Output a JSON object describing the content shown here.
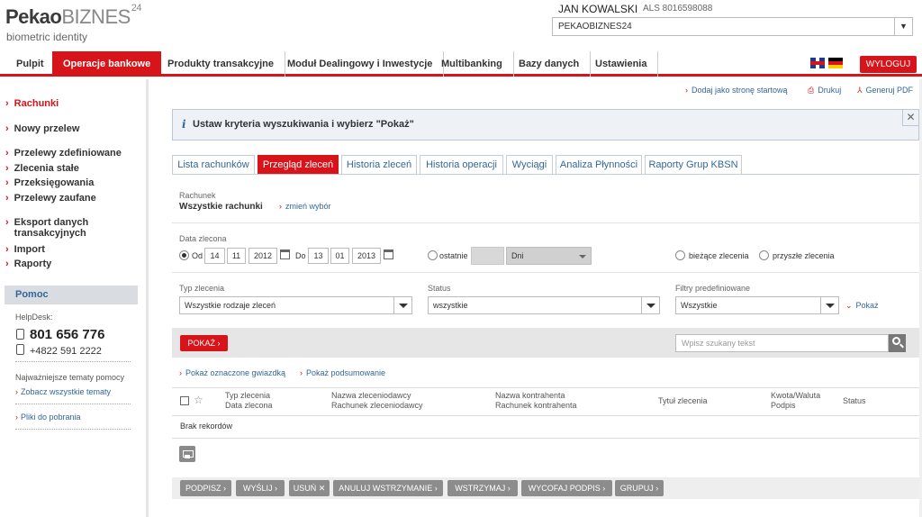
{
  "brand": {
    "logo_pekao": "Pekao",
    "logo_bizness": "BIZNES",
    "logo_sup": "24",
    "tagline": "biometric identity"
  },
  "user": {
    "name": "JAN KOWALSKI",
    "als": "ALS 8016598088",
    "context": "PEKAOBIZNES24"
  },
  "nav": {
    "items": [
      {
        "label": "Pulpit"
      },
      {
        "label": "Operacje bankowe"
      },
      {
        "label": "Produkty transakcyjne"
      },
      {
        "label": "Moduł Dealingowy i Inwestycje"
      },
      {
        "label": "Multibanking"
      },
      {
        "label": "Bazy danych"
      },
      {
        "label": "Ustawienia"
      }
    ],
    "logout": "WYLOGUJ"
  },
  "sidebar": {
    "items": [
      {
        "label": "Rachunki"
      },
      {
        "label": "Nowy przelew"
      },
      {
        "label": "Przelewy zdefiniowane"
      },
      {
        "label": "Zlecenia stałe"
      },
      {
        "label": "Przeksięgowania"
      },
      {
        "label": "Przelewy zaufane"
      },
      {
        "label": "Eksport danych"
      },
      {
        "label": "transakcyjnych"
      },
      {
        "label": "Import"
      },
      {
        "label": "Raporty"
      }
    ],
    "help": {
      "title": "Pomoc",
      "helpdesk_label": "HelpDesk:",
      "phone1": "801 656 776",
      "phone2": "+4822 591 2222",
      "topics_label": "Najważniejsze tematy pomocy",
      "all_topics": "Zobacz wszystkie tematy",
      "downloads": "Pliki do pobrania"
    }
  },
  "top_actions": {
    "add_start": "Dodaj jako stronę startową",
    "print": "Drukuj",
    "pdf": "Generuj PDF"
  },
  "info": {
    "icon": "i",
    "message": "Ustaw kryteria wyszukiwania i wybierz \"Pokaż\"",
    "close": "✕"
  },
  "tabs": [
    {
      "label": "Lista rachunków"
    },
    {
      "label": "Przegląd zleceń"
    },
    {
      "label": "Historia zleceń"
    },
    {
      "label": "Historia operacji"
    },
    {
      "label": "Wyciągi"
    },
    {
      "label": "Analiza Płynności"
    },
    {
      "label": "Raporty Grup KBSN"
    }
  ],
  "account": {
    "label": "Rachunek",
    "value": "Wszystkie rachunki",
    "change": "zmień wybór"
  },
  "date": {
    "label": "Data zlecona",
    "from_label": "Od",
    "from_day": "14",
    "from_month": "11",
    "from_year": "2012",
    "to_label": "Do",
    "to_day": "13",
    "to_month": "01",
    "to_year": "2013",
    "last_label": "ostatnie",
    "unit": "Dni",
    "current": "bieżące zlecenia",
    "future": "przyszłe zlecenia"
  },
  "filters": {
    "type_label": "Typ zlecenia",
    "type_value": "Wszystkie rodzaje zleceń",
    "status_label": "Status",
    "status_value": "wszystkie",
    "predef_label": "Filtry predefiniowane",
    "predef_value": "Wszystkie",
    "show_link": "Pokaż"
  },
  "actions": {
    "show_button": "POKAŻ",
    "search_placeholder": "Wpisz szukany tekst",
    "show_starred": "Pokaż oznaczone gwiazdką",
    "show_summary": "Pokaż podsumowanie"
  },
  "table": {
    "col1a": "Typ zlecenia",
    "col1b": "Data zlecona",
    "col2a": "Nazwa zleceniodawcy",
    "col2b": "Rachunek zleceniodawcy",
    "col3a": "Nazwa kontrahenta",
    "col3b": "Rachunek kontrahenta",
    "col4": "Tytuł zlecenia",
    "col5a": "Kwota/Waluta",
    "col5b": "Podpis",
    "col6": "Status",
    "empty": "Brak rekordów"
  },
  "bottom_buttons": [
    {
      "label": "PODPISZ"
    },
    {
      "label": "WYŚLIJ"
    },
    {
      "label": "USUŃ"
    },
    {
      "label": "ANULUJ WSTRZYMANIE"
    },
    {
      "label": "WSTRZYMAJ"
    },
    {
      "label": "WYCOFAJ PODPIS"
    },
    {
      "label": "GRUPUJ"
    }
  ],
  "colors": {
    "accent": "#d7141a",
    "link": "#336699",
    "button_grey": "#8c8c8c"
  }
}
